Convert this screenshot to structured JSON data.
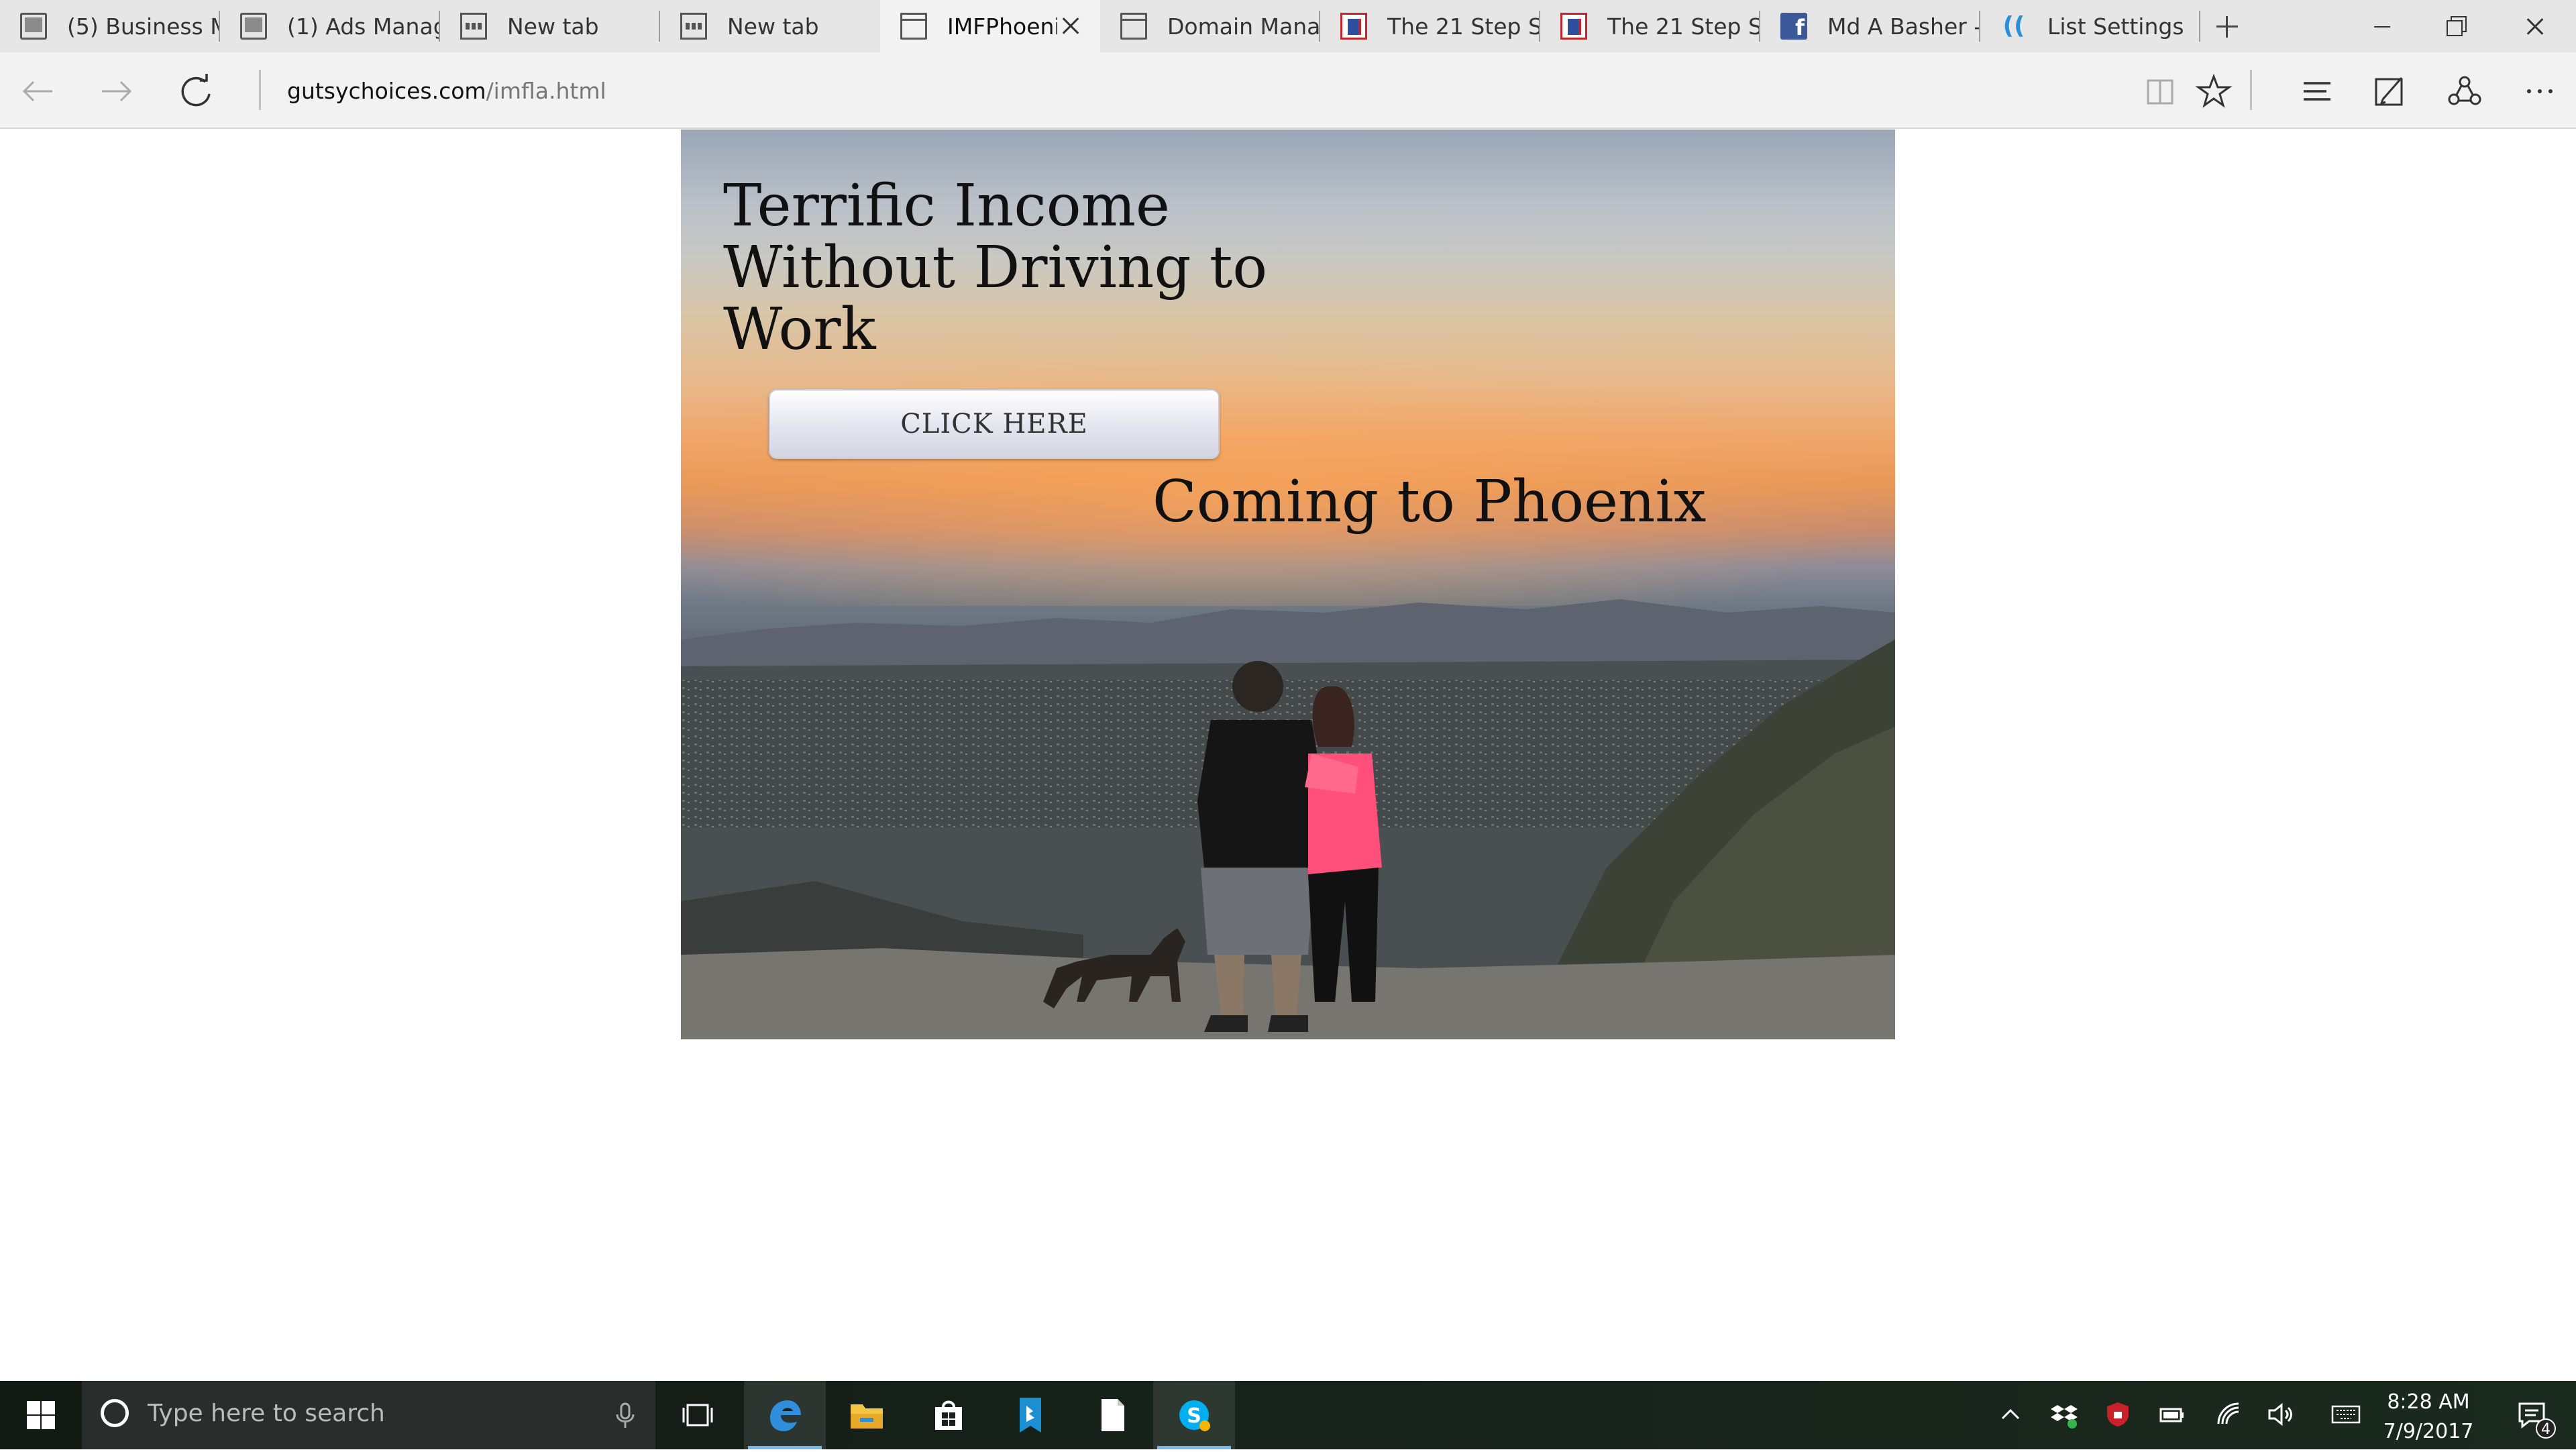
{
  "browser": {
    "tabs": [
      {
        "title": "(5) Business Ma",
        "icon": "page-icon",
        "active": false
      },
      {
        "title": "(1) Ads Manage",
        "icon": "page-icon",
        "active": false
      },
      {
        "title": "New tab",
        "icon": "grid-icon",
        "active": false
      },
      {
        "title": "New tab",
        "icon": "grid-icon",
        "active": false
      },
      {
        "title": "IMFPhoenix",
        "icon": "window-icon",
        "active": true
      },
      {
        "title": "Domain Manag",
        "icon": "window-icon",
        "active": false
      },
      {
        "title": "The 21 Step Suc",
        "icon": "book-icon",
        "active": false
      },
      {
        "title": "The 21 Step Suc",
        "icon": "book-icon",
        "active": false
      },
      {
        "title": "Md A Basher - I",
        "icon": "facebook-icon",
        "active": false
      },
      {
        "title": "List Settings",
        "icon": "aweber-icon",
        "active": false
      }
    ],
    "address": {
      "domain": "gutsychoices.com",
      "path": "/imfla.html"
    }
  },
  "page": {
    "headline": "Terrific Income Without Driving to Work",
    "cta_label": "CLICK HERE",
    "subheadline": "Coming to Phoenix"
  },
  "taskbar": {
    "search_placeholder": "Type here to search",
    "time": "8:28 AM",
    "date": "7/9/2017",
    "notification_count": "4",
    "pinned_apps": [
      "edge-icon",
      "file-explorer-icon",
      "store-icon",
      "bing-icon",
      "document-icon",
      "skype-icon"
    ]
  },
  "colors": {
    "accent_underline": "#79b8e6",
    "cta_background": "#e4e4ee"
  }
}
